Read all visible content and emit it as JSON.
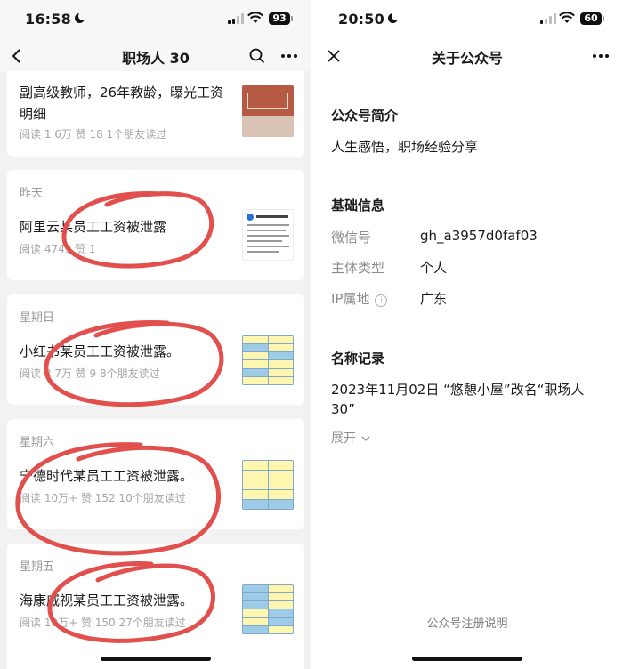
{
  "left": {
    "status": {
      "time": "16:58",
      "battery": "93"
    },
    "nav": {
      "title": "职场人 30"
    },
    "articles": [
      {
        "day": "",
        "title": "副高级教师，26年教龄，曝光工资明细",
        "meta": "阅读 1.6万  赞 18  1个朋友读过"
      },
      {
        "day": "昨天",
        "title": "阿里云某员工工资被泄露",
        "meta": "阅读 4749  赞 1"
      },
      {
        "day": "星期日",
        "title": "小红书某员工工资被泄露。",
        "meta": "阅读 3.7万  赞 9  8个朋友读过"
      },
      {
        "day": "星期六",
        "title": "宁德时代某员工工资被泄露。",
        "meta": "阅读 10万+  赞 152  10个朋友读过"
      },
      {
        "day": "星期五",
        "title": "海康威视某员工工资被泄露。",
        "meta": "阅读 10万+  赞 150  27个朋友读过"
      }
    ]
  },
  "right": {
    "status": {
      "time": "20:50",
      "battery": "60"
    },
    "nav": {
      "title": "关于公众号"
    },
    "intro": {
      "heading": "公众号简介",
      "text": "人生感悟，职场经验分享"
    },
    "basic": {
      "heading": "基础信息",
      "rows": [
        {
          "label": "微信号",
          "value": "gh_a3957d0faf03"
        },
        {
          "label": "主体类型",
          "value": "个人"
        },
        {
          "label": "IP属地",
          "value": "广东"
        }
      ]
    },
    "name_history": {
      "heading": "名称记录",
      "line1": "2023年11月02日 “悠憩小屋”改名“职场人",
      "line2": "30”",
      "expand": "展开"
    },
    "footer": "公众号注册说明"
  },
  "colors": {
    "annotation": "#e2504d",
    "page_bg": "#f2f2f2",
    "card_bg": "#ffffff",
    "meta_text": "#a6a6a6"
  }
}
